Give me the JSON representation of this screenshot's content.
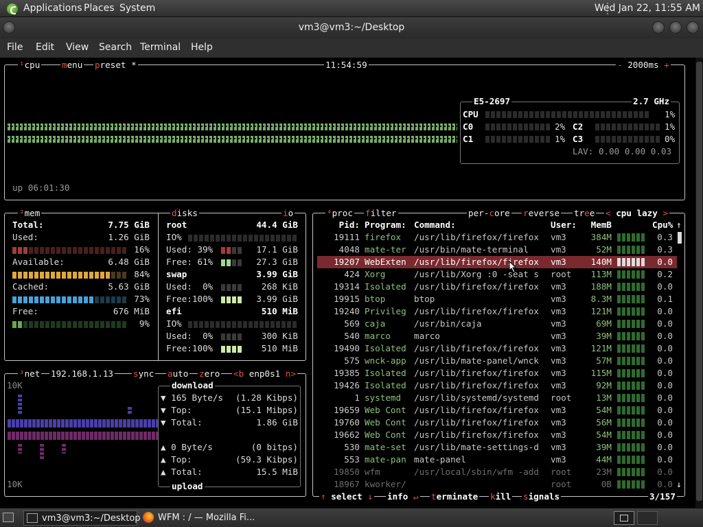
{
  "panel": {
    "applications": "Applications",
    "places": "Places",
    "system": "System",
    "clock": "Wed Jan 22, 11:55 AM"
  },
  "window": {
    "title": "vm3@vm3:~/Desktop",
    "menu": [
      "File",
      "Edit",
      "View",
      "Search",
      "Terminal",
      "Help"
    ]
  },
  "cpu": {
    "title_num": "¹",
    "title": "cpu",
    "menu": "menu",
    "preset": "preset *",
    "time": "11:54:59",
    "minus": "-",
    "interval": "2000ms",
    "plus": "+",
    "uptime": "up 06:01:30",
    "model": "E5-2697",
    "freq": "2.7 GHz",
    "total_label": "CPU",
    "total_pct": "1%",
    "cores": [
      {
        "name": "C0",
        "pct": "2%"
      },
      {
        "name": "C2",
        "pct": "1%"
      },
      {
        "name": "C1",
        "pct": "1%"
      },
      {
        "name": "C3",
        "pct": "0%"
      }
    ],
    "lav_label": "LAV:",
    "lav": "0.00 0.00 0.03"
  },
  "mem": {
    "title_num": "²",
    "title": "mem",
    "total_label": "Total:",
    "total": "7.75 GiB",
    "used_label": "Used:",
    "used": "1.26 GiB",
    "used_pct": "16%",
    "used_frac": 0.16,
    "avail_label": "Available:",
    "avail": "6.48 GiB",
    "avail_pct": "84%",
    "avail_frac": 0.84,
    "cached_label": "Cached:",
    "cached": "5.63 GiB",
    "cached_pct": "73%",
    "cached_frac": 0.73,
    "free_label": "Free:",
    "free": "676 MiB",
    "free_pct": "9%",
    "free_frac": 0.09
  },
  "disks": {
    "title": "disks",
    "io": "io",
    "root": {
      "name": "root",
      "size": "44.4 GiB",
      "io": "IO%",
      "used_label": "Used: 39%",
      "used": "17.1 GiB",
      "free_label": "Free: 61%",
      "free": "27.3 GiB"
    },
    "swap": {
      "name": "swap",
      "size": "3.99 GiB",
      "used_label": "Used:  0%",
      "used": "268 KiB",
      "free_label": "Free:100%",
      "free": "3.99 GiB"
    },
    "efi": {
      "name": "efi",
      "size": "510 MiB",
      "io": "IO%",
      "used_label": "Used:  0%",
      "used": "300 KiB",
      "free_label": "Free:100%",
      "free": "510 MiB"
    }
  },
  "net": {
    "title_num": "³",
    "title": "net",
    "ip": "192.168.1.13",
    "sync": "sync",
    "auto": "auto",
    "zero": "zero",
    "iface_prev": "<b",
    "iface": "enp0s1",
    "iface_next": "n>",
    "scale_top": "10K",
    "scale_bottom": "10K",
    "download_label": "download",
    "dl_rate": "165 Byte/s",
    "dl_rate_bits": "(1.28 Kibps)",
    "dl_top_label": "Top:",
    "dl_top": "(15.1 Mibps)",
    "dl_total_label": "Total:",
    "dl_total": "1.86 GiB",
    "ul_rate": "0 Byte/s",
    "ul_rate_bits": "(0 bitps)",
    "ul_top_label": "Top:",
    "ul_top": "(59.3 Kibps)",
    "ul_total_label": "Total:",
    "ul_total": "15.5 MiB",
    "upload_label": "upload"
  },
  "proc": {
    "title_num": "⁴",
    "title": "proc",
    "filter": "filter",
    "per_core": "per-core",
    "reverse": "reverse",
    "tree": "tree",
    "sort_prev": "<",
    "sort": "cpu lazy",
    "sort_next": ">",
    "headers": {
      "pid": "Pid:",
      "program": "Program:",
      "command": "Command:",
      "user": "User:",
      "mem": "MemB",
      "cpu": "Cpu%"
    },
    "rows": [
      {
        "pid": "19111",
        "program": "firefox",
        "command": "/usr/lib/firefox/firefox",
        "user": "vm3",
        "mem": "384M",
        "cpu": "0.3"
      },
      {
        "pid": "4048",
        "program": "mate-ter",
        "command": "/usr/bin/mate-terminal",
        "user": "vm3",
        "mem": "52M",
        "cpu": "0.3"
      },
      {
        "pid": "19207",
        "program": "WebExten",
        "command": "/usr/lib/firefox/firefox",
        "user": "vm3",
        "mem": "140M",
        "cpu": "0.0"
      },
      {
        "pid": "424",
        "program": "Xorg",
        "command": "/usr/lib/Xorg :0 -seat s",
        "user": "root",
        "mem": "113M",
        "cpu": "0.2"
      },
      {
        "pid": "19314",
        "program": "Isolated",
        "command": "/usr/lib/firefox/firefox",
        "user": "vm3",
        "mem": "188M",
        "cpu": "0.0"
      },
      {
        "pid": "19915",
        "program": "btop",
        "command": "btop",
        "user": "vm3",
        "mem": "8.3M",
        "cpu": "0.1"
      },
      {
        "pid": "19240",
        "program": "Privileg",
        "command": "/usr/lib/firefox/firefox",
        "user": "vm3",
        "mem": "121M",
        "cpu": "0.0"
      },
      {
        "pid": "569",
        "program": "caja",
        "command": "/usr/bin/caja",
        "user": "vm3",
        "mem": "69M",
        "cpu": "0.0"
      },
      {
        "pid": "540",
        "program": "marco",
        "command": "marco",
        "user": "vm3",
        "mem": "39M",
        "cpu": "0.0"
      },
      {
        "pid": "19490",
        "program": "Isolated",
        "command": "/usr/lib/firefox/firefox",
        "user": "vm3",
        "mem": "121M",
        "cpu": "0.0"
      },
      {
        "pid": "575",
        "program": "wnck-app",
        "command": "/usr/lib/mate-panel/wnck",
        "user": "vm3",
        "mem": "57M",
        "cpu": "0.0"
      },
      {
        "pid": "19385",
        "program": "Isolated",
        "command": "/usr/lib/firefox/firefox",
        "user": "vm3",
        "mem": "115M",
        "cpu": "0.0"
      },
      {
        "pid": "19426",
        "program": "Isolated",
        "command": "/usr/lib/firefox/firefox",
        "user": "vm3",
        "mem": "92M",
        "cpu": "0.0"
      },
      {
        "pid": "1",
        "program": "systemd",
        "command": "/usr/lib/systemd/systemd",
        "user": "root",
        "mem": "13M",
        "cpu": "0.0"
      },
      {
        "pid": "19659",
        "program": "Web Cont",
        "command": "/usr/lib/firefox/firefox",
        "user": "vm3",
        "mem": "54M",
        "cpu": "0.0"
      },
      {
        "pid": "19760",
        "program": "Web Cont",
        "command": "/usr/lib/firefox/firefox",
        "user": "vm3",
        "mem": "56M",
        "cpu": "0.0"
      },
      {
        "pid": "19662",
        "program": "Web Cont",
        "command": "/usr/lib/firefox/firefox",
        "user": "vm3",
        "mem": "54M",
        "cpu": "0.0"
      },
      {
        "pid": "530",
        "program": "mate-set",
        "command": "/usr/lib/mate-settings-d",
        "user": "vm3",
        "mem": "39M",
        "cpu": "0.0"
      },
      {
        "pid": "553",
        "program": "mate-pan",
        "command": "mate-panel",
        "user": "vm3",
        "mem": "44M",
        "cpu": "0.0"
      },
      {
        "pid": "19850",
        "program": "wfm",
        "command": "/usr/local/sbin/wfm -add",
        "user": "root",
        "mem": "23M",
        "cpu": "0.0"
      },
      {
        "pid": "18967",
        "program": "kworker/",
        "command": "",
        "user": "root",
        "mem": "0B",
        "cpu": "0.0"
      }
    ],
    "selected_index": 2,
    "footer": {
      "up": "↑",
      "select": "select",
      "down": "↓",
      "info": "info",
      "enter": "↵",
      "terminate": "terminate",
      "kill": "kill",
      "signals": "signals",
      "count": "3/157"
    }
  },
  "taskbar": {
    "task1": "vm3@vm3:~/Desktop",
    "task2": "WFM : / — Mozilla Fi..."
  },
  "colors": {
    "accent_red": "#e05050",
    "green": "#8ec07c",
    "selection": "#7a2a2e"
  }
}
